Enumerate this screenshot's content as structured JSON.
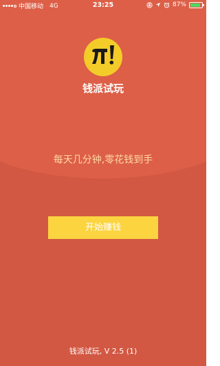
{
  "status_bar": {
    "carrier": "中国移动",
    "network": "4G",
    "time": "23:25",
    "battery_percent": "87%",
    "battery_level": 0.87,
    "icons": [
      "lock-rotation-icon",
      "location-arrow-icon",
      "alarm-icon"
    ]
  },
  "app": {
    "logo_text": "π!",
    "name": "钱派试玩",
    "tagline": "每天几分钟,零花钱到手",
    "start_button_label": "开始赚钱",
    "version_text": "钱派试玩, V 2.5 (1)"
  },
  "colors": {
    "background": "#d25843",
    "top_panel": "#dd5f47",
    "logo_circle": "#f4cc29",
    "button": "#fbd43f",
    "tagline": "#ffd9a8",
    "battery_fill": "#4cd964"
  }
}
